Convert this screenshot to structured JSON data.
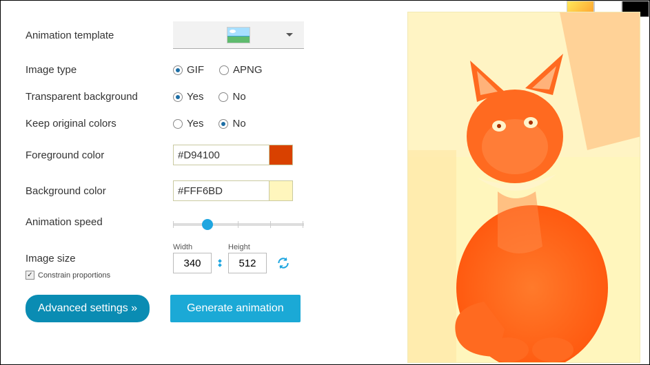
{
  "swatches": {
    "grad": "#ffc23a",
    "white": "#ffffff",
    "black": "#000000"
  },
  "form": {
    "template_label": "Animation template",
    "image_type_label": "Image type",
    "image_type": {
      "opt1": "GIF",
      "opt2": "APNG",
      "selected": "GIF"
    },
    "transparent_label": "Transparent background",
    "transparent": {
      "opt1": "Yes",
      "opt2": "No",
      "selected": "Yes"
    },
    "keep_colors_label": "Keep original colors",
    "keep_colors": {
      "opt1": "Yes",
      "opt2": "No",
      "selected": "No"
    },
    "fg_label": "Foreground color",
    "fg_value": "#D94100",
    "bg_label": "Background color",
    "bg_value": "#FFF6BD",
    "speed_label": "Animation speed",
    "size_label": "Image size",
    "width_label": "Width",
    "height_label": "Height",
    "width_value": "340",
    "height_value": "512",
    "constrain_label": "Constrain proportions",
    "constrain_checked": true
  },
  "buttons": {
    "advanced": "Advanced settings »",
    "generate": "Generate animation"
  },
  "colors": {
    "fg": "#D94100",
    "bg": "#FFF6BD"
  }
}
